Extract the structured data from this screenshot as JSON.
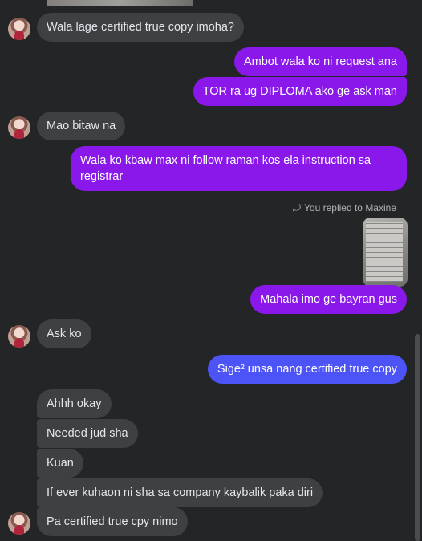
{
  "messages": {
    "m1": "Wala lage certified true copy imoha?",
    "m2": "Ambot wala ko ni request ana",
    "m3": "TOR ra ug DIPLOMA ako ge ask man",
    "m4": "Mao bitaw na",
    "m5_line1": "Wala ko kbaw max ni follow raman kos ela instruction sa",
    "m5_line2": "registrar",
    "reply_note": "You replied to Maxine",
    "m6": "Mahala imo ge bayran gus",
    "m7": "Ask ko",
    "m8": "Sige² unsa nang certified true copy",
    "m9": "Ahhh okay",
    "m10": "Needed jud sha",
    "m11": "Kuan",
    "m12": "If ever kuhaon ni sha sa company kaybalik paka diri",
    "m13": "Pa certified true cpy nimo"
  },
  "icons": {
    "reply": "reply-arrow-icon",
    "avatar": "contact-avatar"
  },
  "colors": {
    "background": "#242526",
    "incoming": "#3e4042",
    "outgoing_purple": "#8a18ea",
    "outgoing_blue": "#4c53f7",
    "text": "#e4e6eb",
    "muted": "#b0b3b8"
  }
}
